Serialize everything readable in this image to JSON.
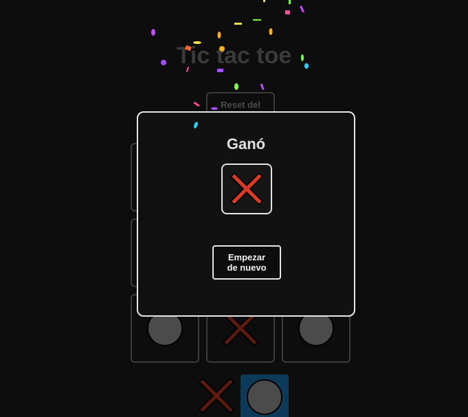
{
  "game": {
    "title": "Tic tac toe",
    "reset_label": "Reset del"
  },
  "board": [
    [
      "",
      "",
      ""
    ],
    [
      "",
      "",
      ""
    ],
    [
      "O",
      "X",
      "O"
    ]
  ],
  "turn_indicator": [
    {
      "mark": "X",
      "active": false
    },
    {
      "mark": "O",
      "active": true
    }
  ],
  "winner_modal": {
    "title": "Ganó",
    "winner": "X",
    "new_game_label_line1": "Empezar",
    "new_game_label_line2": "de nuevo"
  },
  "colors": {
    "background": "#0d0d0d",
    "x_winner": "#d93a24",
    "x_dim": "#5a1a10",
    "o_fill": "#4b4b4b",
    "active_turn": "#0c3a58",
    "confetti": [
      "#ff4d9d",
      "#a64dff",
      "#ffb020",
      "#2ecfff",
      "#7cff4d",
      "#ffe14d",
      "#ff6b35",
      "#c04dff"
    ]
  }
}
